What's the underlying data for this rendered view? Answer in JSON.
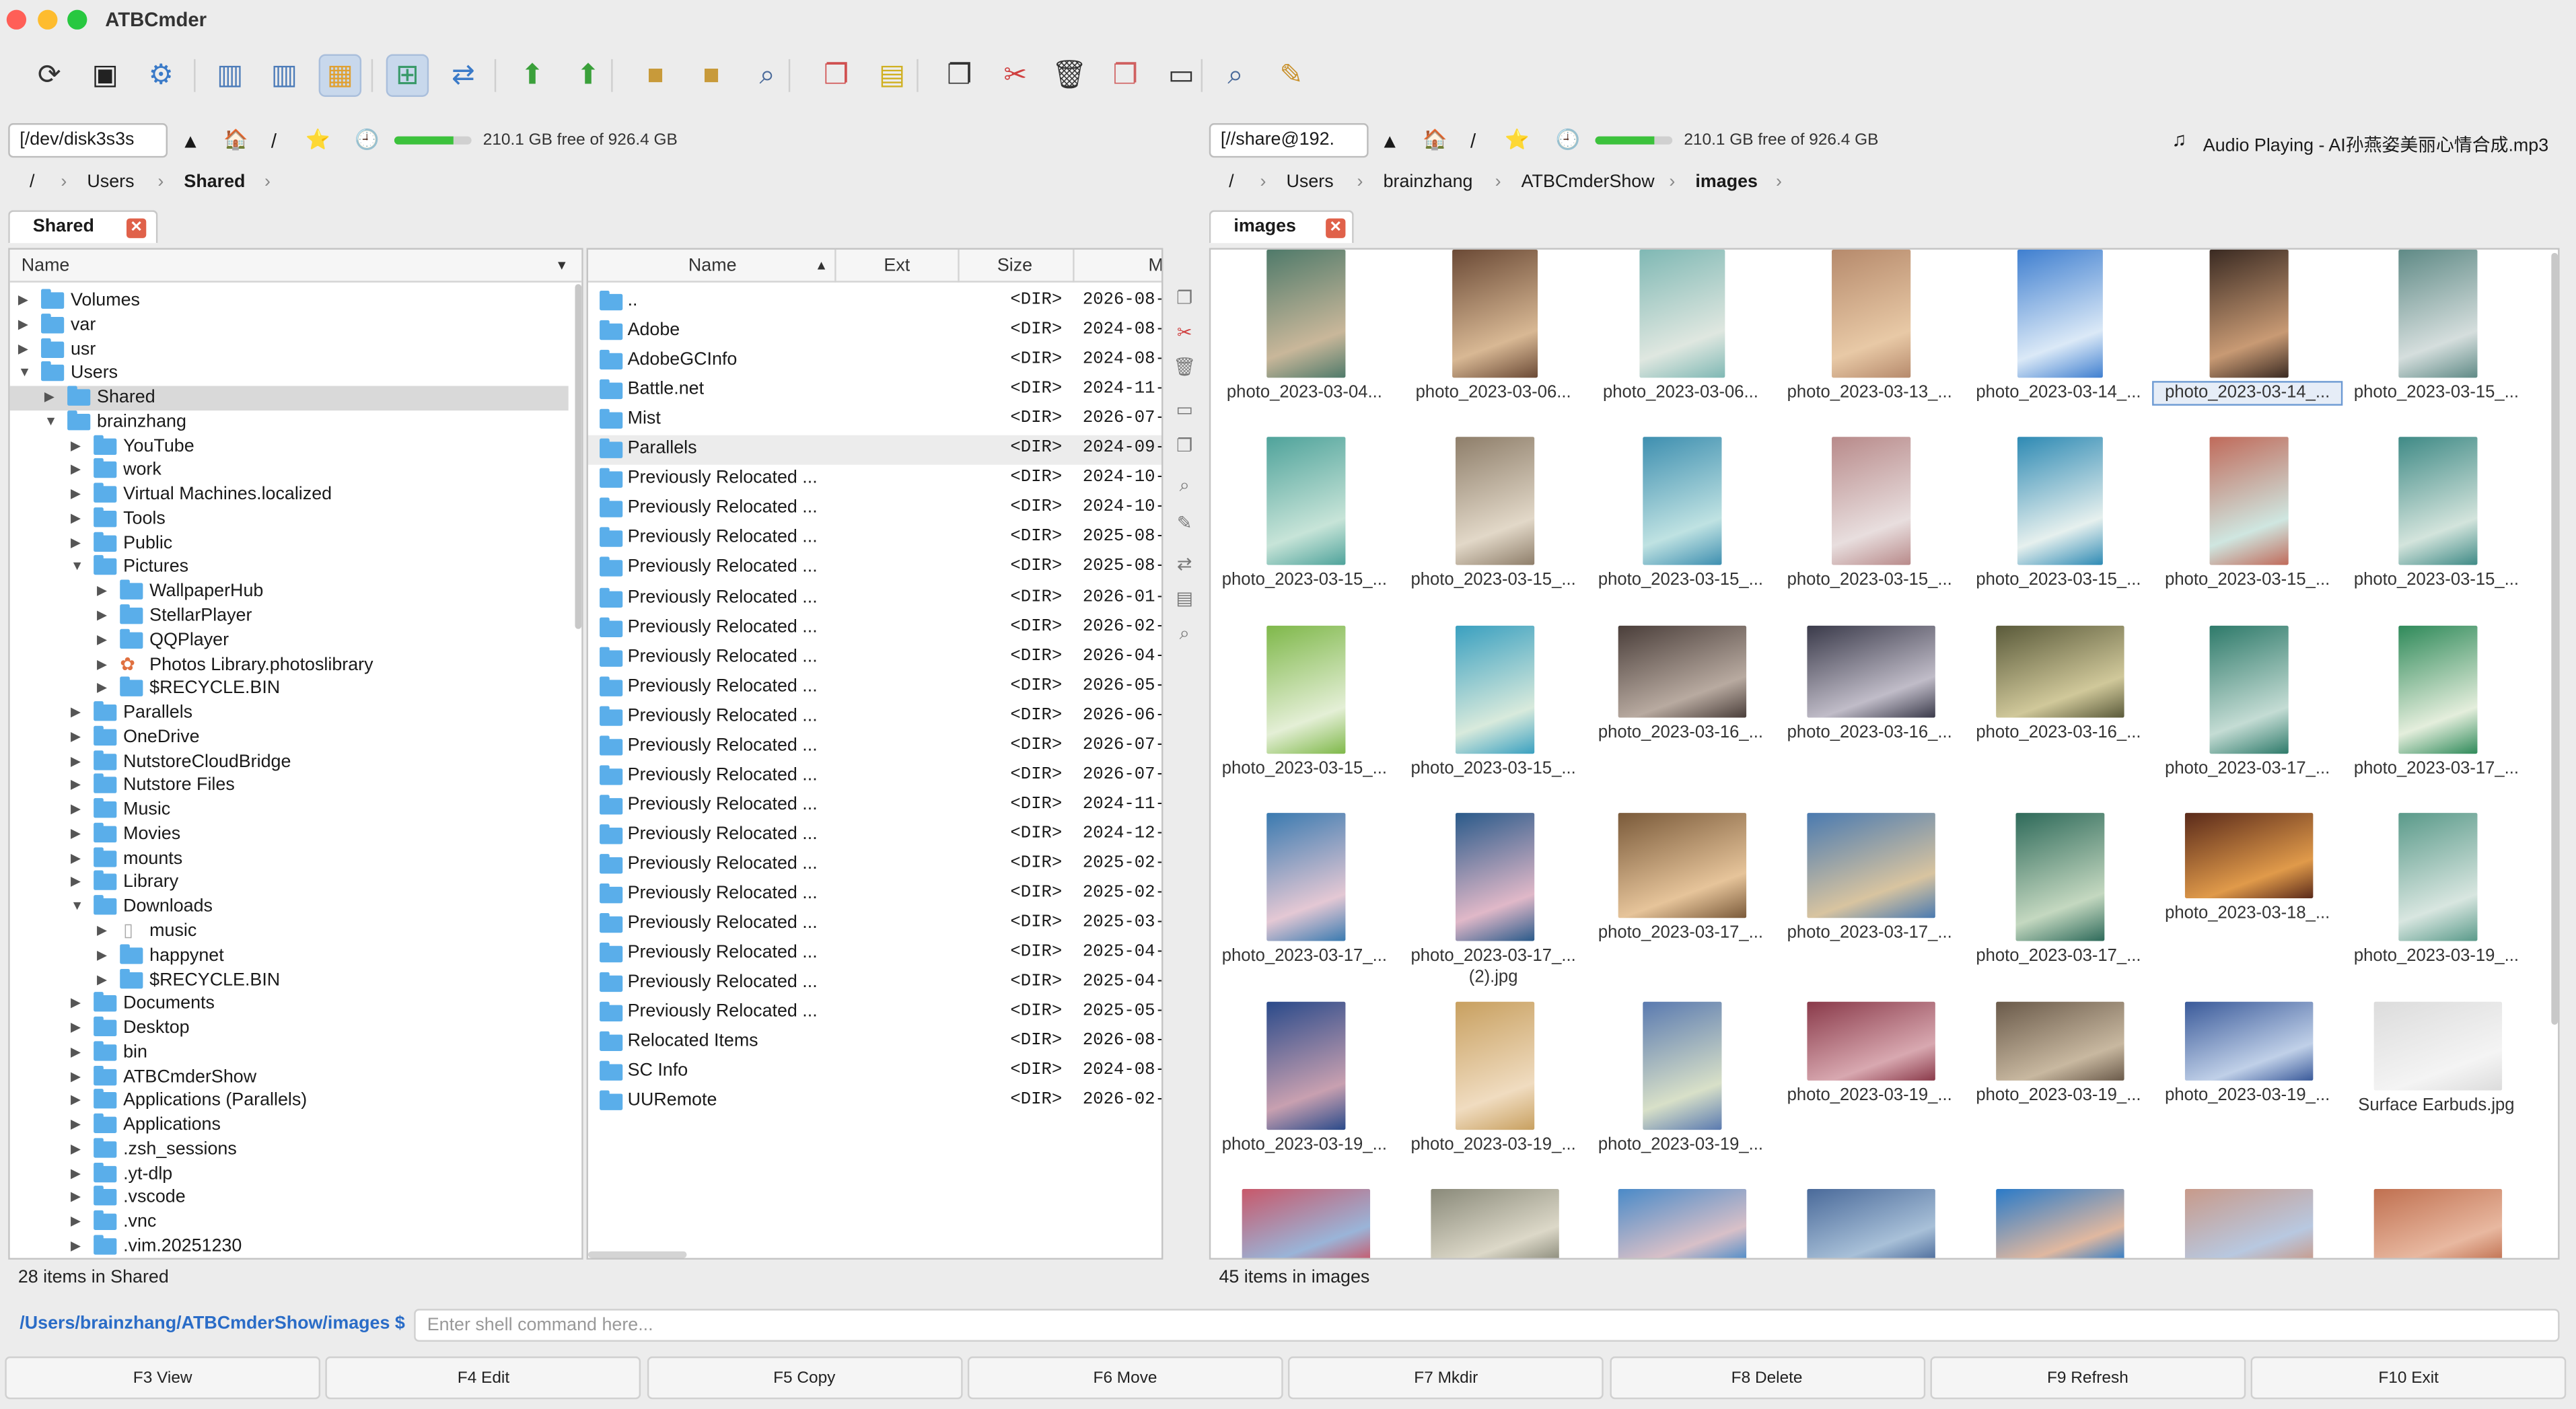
{
  "window": {
    "title": "ATBCmder",
    "colors": {
      "close": "#ff5f57",
      "min": "#febc2e",
      "max": "#28c840"
    }
  },
  "toolbar": {
    "buttons": [
      "refresh-icon",
      "terminal-icon",
      "settings-icon",
      "panel-left-icon",
      "panel-right-icon",
      "layout-icon",
      "tree-toggle-icon",
      "sync-icon",
      "upload-icon",
      "up-icon",
      "pack-icon",
      "unpack-icon",
      "search-files-icon",
      "copy-files-icon",
      "move-files-icon",
      "copy-icon",
      "cut-icon",
      "delete-icon",
      "rename-icon",
      "new-folder-icon",
      "find-icon",
      "edit-icon"
    ]
  },
  "left": {
    "path": "[/dev/disk3s3s",
    "free_text": "210.1 GB free of 926.4 GB",
    "disk_used": 0.773,
    "crumbs": [
      "/",
      "Users",
      "Shared"
    ],
    "tab": "Shared",
    "tree_header": "Name",
    "tree": [
      {
        "label": "Volumes",
        "depth": 0,
        "open": false
      },
      {
        "label": "var",
        "depth": 0,
        "open": false
      },
      {
        "label": "usr",
        "depth": 0,
        "open": false
      },
      {
        "label": "Users",
        "depth": 0,
        "open": true
      },
      {
        "label": "Shared",
        "depth": 1,
        "open": false,
        "selected": true
      },
      {
        "label": "brainzhang",
        "depth": 1,
        "open": true
      },
      {
        "label": "YouTube",
        "depth": 2,
        "open": false
      },
      {
        "label": "work",
        "depth": 2,
        "open": false
      },
      {
        "label": "Virtual Machines.localized",
        "depth": 2,
        "open": false
      },
      {
        "label": "Tools",
        "depth": 2,
        "open": false
      },
      {
        "label": "Public",
        "depth": 2,
        "open": false
      },
      {
        "label": "Pictures",
        "depth": 2,
        "open": true
      },
      {
        "label": "WallpaperHub",
        "depth": 3,
        "open": false
      },
      {
        "label": "StellarPlayer",
        "depth": 3,
        "open": false
      },
      {
        "label": "QQPlayer",
        "depth": 3,
        "open": false
      },
      {
        "label": "Photos Library.photoslibrary",
        "depth": 3,
        "open": false,
        "photos": true
      },
      {
        "label": "$RECYCLE.BIN",
        "depth": 3,
        "open": false
      },
      {
        "label": "Parallels",
        "depth": 2,
        "open": false
      },
      {
        "label": "OneDrive",
        "depth": 2,
        "open": false
      },
      {
        "label": "NutstoreCloudBridge",
        "depth": 2,
        "open": false
      },
      {
        "label": "Nutstore Files",
        "depth": 2,
        "open": false
      },
      {
        "label": "Music",
        "depth": 2,
        "open": false
      },
      {
        "label": "Movies",
        "depth": 2,
        "open": false
      },
      {
        "label": "mounts",
        "depth": 2,
        "open": false
      },
      {
        "label": "Library",
        "depth": 2,
        "open": false
      },
      {
        "label": "Downloads",
        "depth": 2,
        "open": true
      },
      {
        "label": "music",
        "depth": 3,
        "open": false,
        "file": true
      },
      {
        "label": "happynet",
        "depth": 3,
        "open": false
      },
      {
        "label": "$RECYCLE.BIN",
        "depth": 3,
        "open": false
      },
      {
        "label": "Documents",
        "depth": 2,
        "open": false
      },
      {
        "label": "Desktop",
        "depth": 2,
        "open": false
      },
      {
        "label": "bin",
        "depth": 2,
        "open": false
      },
      {
        "label": "ATBCmderShow",
        "depth": 2,
        "open": false
      },
      {
        "label": "Applications (Parallels)",
        "depth": 2,
        "open": false
      },
      {
        "label": "Applications",
        "depth": 2,
        "open": false
      },
      {
        "label": ".zsh_sessions",
        "depth": 2,
        "open": false
      },
      {
        "label": ".yt-dlp",
        "depth": 2,
        "open": false
      },
      {
        "label": ".vscode",
        "depth": 2,
        "open": false
      },
      {
        "label": ".vnc",
        "depth": 2,
        "open": false
      },
      {
        "label": ".vim.20251230",
        "depth": 2,
        "open": false
      }
    ],
    "list_headers": {
      "name": "Name",
      "ext": "Ext",
      "size": "Size",
      "modified": "M"
    },
    "list": [
      {
        "name": "..",
        "size": "<DIR>",
        "date": "2026-08-"
      },
      {
        "name": "Adobe",
        "size": "<DIR>",
        "date": "2024-08-"
      },
      {
        "name": "AdobeGCInfo",
        "size": "<DIR>",
        "date": "2024-08-"
      },
      {
        "name": "Battle.net",
        "size": "<DIR>",
        "date": "2024-11-"
      },
      {
        "name": "Mist",
        "size": "<DIR>",
        "date": "2026-07-"
      },
      {
        "name": "Parallels",
        "size": "<DIR>",
        "date": "2024-09-",
        "selected": true
      },
      {
        "name": "Previously Relocated ...",
        "size": "<DIR>",
        "date": "2024-10-"
      },
      {
        "name": "Previously Relocated ...",
        "size": "<DIR>",
        "date": "2024-10-"
      },
      {
        "name": "Previously Relocated ...",
        "size": "<DIR>",
        "date": "2025-08-"
      },
      {
        "name": "Previously Relocated ...",
        "size": "<DIR>",
        "date": "2025-08-"
      },
      {
        "name": "Previously Relocated ...",
        "size": "<DIR>",
        "date": "2026-01-"
      },
      {
        "name": "Previously Relocated ...",
        "size": "<DIR>",
        "date": "2026-02-"
      },
      {
        "name": "Previously Relocated ...",
        "size": "<DIR>",
        "date": "2026-04-"
      },
      {
        "name": "Previously Relocated ...",
        "size": "<DIR>",
        "date": "2026-05-"
      },
      {
        "name": "Previously Relocated ...",
        "size": "<DIR>",
        "date": "2026-06-"
      },
      {
        "name": "Previously Relocated ...",
        "size": "<DIR>",
        "date": "2026-07-"
      },
      {
        "name": "Previously Relocated ...",
        "size": "<DIR>",
        "date": "2026-07-"
      },
      {
        "name": "Previously Relocated ...",
        "size": "<DIR>",
        "date": "2024-11-"
      },
      {
        "name": "Previously Relocated ...",
        "size": "<DIR>",
        "date": "2024-12-"
      },
      {
        "name": "Previously Relocated ...",
        "size": "<DIR>",
        "date": "2025-02-"
      },
      {
        "name": "Previously Relocated ...",
        "size": "<DIR>",
        "date": "2025-02-"
      },
      {
        "name": "Previously Relocated ...",
        "size": "<DIR>",
        "date": "2025-03-"
      },
      {
        "name": "Previously Relocated ...",
        "size": "<DIR>",
        "date": "2025-04-"
      },
      {
        "name": "Previously Relocated ...",
        "size": "<DIR>",
        "date": "2025-04-"
      },
      {
        "name": "Previously Relocated ...",
        "size": "<DIR>",
        "date": "2025-05-"
      },
      {
        "name": "Relocated Items",
        "size": "<DIR>",
        "date": "2026-08-"
      },
      {
        "name": "SC Info",
        "size": "<DIR>",
        "date": "2024-08-"
      },
      {
        "name": "UURemote",
        "size": "<DIR>",
        "date": "2026-02-"
      }
    ],
    "status": "28 items in Shared"
  },
  "right": {
    "path": "[//share@192.",
    "free_text": "210.1 GB free of 926.4 GB",
    "disk_used": 0.773,
    "audio": "Audio Playing - AI孙燕姿美丽心情合成.mp3",
    "crumbs": [
      "/",
      "Users",
      "brainzhang",
      "ATBCmderShow",
      "images"
    ],
    "tab": "images",
    "thumbs": [
      {
        "cap": "photo_2023-03-04...",
        "w": 48,
        "c1": "#4f7a6a",
        "c2": "#c9b79a"
      },
      {
        "cap": "photo_2023-03-06...",
        "w": 52,
        "c1": "#6b4a36",
        "c2": "#d8b894"
      },
      {
        "cap": "photo_2023-03-06...",
        "w": 52,
        "c1": "#7fb8b4",
        "c2": "#dfe7e0"
      },
      {
        "cap": "photo_2023-03-13_...",
        "w": 48,
        "c1": "#b68a6c",
        "c2": "#e8c9a6"
      },
      {
        "cap": "photo_2023-03-14_...",
        "w": 52,
        "c1": "#3f7fd0",
        "c2": "#dbe9f7"
      },
      {
        "cap": "photo_2023-03-14_...",
        "w": 48,
        "c1": "#3a2a22",
        "c2": "#c89a74",
        "sel": true
      },
      {
        "cap": "photo_2023-03-15_...",
        "w": 48,
        "c1": "#5f8a86",
        "c2": "#d5dedd"
      },
      {
        "cap": "photo_2023-03-15_...",
        "w": 48,
        "c1": "#4fa39b",
        "c2": "#c7e4d8"
      },
      {
        "cap": "photo_2023-03-15_...",
        "w": 48,
        "c1": "#8e7e6a",
        "c2": "#e2d8c8"
      },
      {
        "cap": "photo_2023-03-15_...",
        "w": 48,
        "c1": "#3e8fb0",
        "c2": "#bfe2e2"
      },
      {
        "cap": "photo_2023-03-15_...",
        "w": 48,
        "c1": "#b88a8a",
        "c2": "#e8dede"
      },
      {
        "cap": "photo_2023-03-15_...",
        "w": 52,
        "c1": "#2e8ab4",
        "c2": "#e6f0ee"
      },
      {
        "cap": "photo_2023-03-15_...",
        "w": 48,
        "c1": "#c06a5a",
        "c2": "#cfe6e0"
      },
      {
        "cap": "photo_2023-03-15_...",
        "w": 48,
        "c1": "#3f8a86",
        "c2": "#d3e4dc"
      },
      {
        "cap": "photo_2023-03-15_...",
        "w": 48,
        "c1": "#7fb84a",
        "c2": "#e4efd6"
      },
      {
        "cap": "photo_2023-03-15_...",
        "w": 48,
        "c1": "#3aa0c0",
        "c2": "#d8eadc"
      },
      {
        "cap": "photo_2023-03-16_...",
        "w": 78,
        "h": 56,
        "c1": "#4a3e3a",
        "c2": "#b8aaa0"
      },
      {
        "cap": "photo_2023-03-16_...",
        "w": 78,
        "h": 56,
        "c1": "#3a3a4a",
        "c2": "#c0bcc8"
      },
      {
        "cap": "photo_2023-03-16_...",
        "w": 78,
        "h": 56,
        "c1": "#5a5a3a",
        "c2": "#d0c89a"
      },
      {
        "cap": "photo_2023-03-17_...",
        "w": 48,
        "c1": "#2e7a6a",
        "c2": "#c4dcd4"
      },
      {
        "cap": "photo_2023-03-17_...",
        "w": 48,
        "c1": "#2f8a5a",
        "c2": "#e4eedc"
      },
      {
        "cap": "photo_2023-03-17_...",
        "w": 48,
        "c1": "#3a7ab0",
        "c2": "#e4c8d4"
      },
      {
        "cap": "photo_2023-03-17_...\n(2).jpg",
        "w": 48,
        "c1": "#2a5a8a",
        "c2": "#e0b8c8"
      },
      {
        "cap": "photo_2023-03-17_...",
        "w": 78,
        "h": 64,
        "c1": "#7a5a3a",
        "c2": "#e6c49a"
      },
      {
        "cap": "photo_2023-03-17_...",
        "w": 78,
        "h": 64,
        "c1": "#4a7ab0",
        "c2": "#d8c4a0"
      },
      {
        "cap": "photo_2023-03-17_...",
        "w": 54,
        "c1": "#2e6a5a",
        "c2": "#c4d8c0"
      },
      {
        "cap": "photo_2023-03-18_...",
        "w": 78,
        "h": 52,
        "c1": "#5a2a1a",
        "c2": "#e09a4a"
      },
      {
        "cap": "photo_2023-03-19_...",
        "w": 48,
        "c1": "#5a9a8a",
        "c2": "#d8e6e0"
      },
      {
        "cap": "photo_2023-03-19_...",
        "w": 48,
        "c1": "#2a4a8a",
        "c2": "#c8a0b0"
      },
      {
        "cap": "photo_2023-03-19_...",
        "w": 48,
        "c1": "#c8a060",
        "c2": "#f0dcc0"
      },
      {
        "cap": "photo_2023-03-19_...",
        "w": 48,
        "c1": "#5a7ab0",
        "c2": "#d8e0c8"
      },
      {
        "cap": "photo_2023-03-19_...",
        "w": 78,
        "h": 48,
        "c1": "#8a3a4a",
        "c2": "#d8a8b0"
      },
      {
        "cap": "photo_2023-03-19_...",
        "w": 78,
        "h": 48,
        "c1": "#6a5a4a",
        "c2": "#c8b8a0"
      },
      {
        "cap": "photo_2023-03-19_...",
        "w": 78,
        "h": 48,
        "c1": "#3a5a9a",
        "c2": "#c0d0e8"
      },
      {
        "cap": "Surface Earbuds.jpg",
        "w": 78,
        "h": 54,
        "c1": "#dcdcdc",
        "c2": "#f4f4f4"
      },
      {
        "cap": "",
        "w": 78,
        "h": 44,
        "c1": "#c8586a",
        "c2": "#9ab4d8"
      },
      {
        "cap": "",
        "w": 78,
        "h": 44,
        "c1": "#8a8a7a",
        "c2": "#dcd8c8"
      },
      {
        "cap": "",
        "w": 78,
        "h": 44,
        "c1": "#4a8ac8",
        "c2": "#d8c0c8"
      },
      {
        "cap": "",
        "w": 78,
        "h": 44,
        "c1": "#4a6a9a",
        "c2": "#a8c0d8"
      },
      {
        "cap": "",
        "w": 78,
        "h": 44,
        "c1": "#2a7ac8",
        "c2": "#e0b8a0"
      },
      {
        "cap": "",
        "w": 78,
        "h": 44,
        "c1": "#c89a8a",
        "c2": "#b8c8e0"
      },
      {
        "cap": "",
        "w": 78,
        "h": 44,
        "c1": "#c07050",
        "c2": "#e8b8a0"
      }
    ],
    "status": "45 items in images"
  },
  "shell": {
    "prompt": "/Users/brainzhang/ATBCmderShow/images $",
    "placeholder": "Enter shell command here..."
  },
  "fkeys": [
    "F3 View",
    "F4 Edit",
    "F5 Copy",
    "F6 Move",
    "F7 Mkdir",
    "F8 Delete",
    "F9 Refresh",
    "F10 Exit"
  ]
}
